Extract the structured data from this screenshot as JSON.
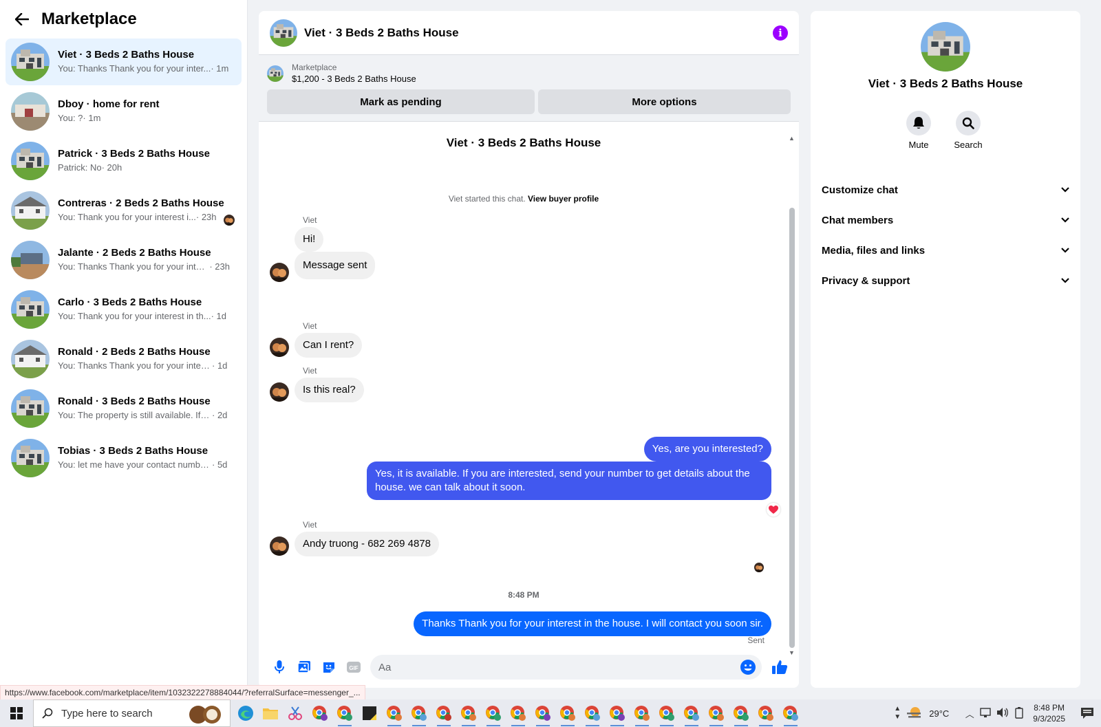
{
  "sidebar": {
    "title": "Marketplace",
    "conversations": [
      {
        "name": "Viet · 3 Beds 2 Baths House",
        "preview": "You: Thanks Thank you for your inter...",
        "time": " · 1m"
      },
      {
        "name": "Dboy · home for rent",
        "preview": "You: ?",
        "time": " · 1m"
      },
      {
        "name": "Patrick · 3 Beds 2 Baths House",
        "preview": "Patrick: No",
        "time": " · 20h"
      },
      {
        "name": "Contreras · 2 Beds 2 Baths House",
        "preview": "You: Thank you for your interest i...",
        "time": " · 23h"
      },
      {
        "name": "Jalante · 2 Beds 2 Baths House",
        "preview": "You: Thanks Thank you for your inter...",
        "time": " · 23h"
      },
      {
        "name": "Carlo · 3 Beds 2 Baths House",
        "preview": "You: Thank you for your interest in th...",
        "time": " · 1d"
      },
      {
        "name": "Ronald · 2 Beds 2 Baths House",
        "preview": "You: Thanks Thank you for your intere...",
        "time": " · 1d"
      },
      {
        "name": "Ronald · 3 Beds 2 Baths House",
        "preview": "You: The property is still available. If y...",
        "time": " · 2d"
      },
      {
        "name": "Tobias · 3 Beds 2 Baths House",
        "preview": "You: let me have your contact number...",
        "time": " · 5d"
      }
    ]
  },
  "chat": {
    "title": "Viet · 3 Beds 2 Baths House",
    "marketplace_label": "Marketplace",
    "item": "$1,200 - 3 Beds 2 Baths House",
    "mark_pending": "Mark as pending",
    "more_options": "More options",
    "thread_title": "Viet · 3 Beds 2 Baths House",
    "started_text": "Viet started this chat.",
    "view_profile": "View buyer profile",
    "sender_name": "Viet",
    "messages": {
      "m1": "Hi!",
      "m2": "Message sent",
      "m3": "Can I rent?",
      "m4": "Is this real?",
      "m5": "Yes, are you interested?",
      "m6": "Yes, it is available. If you are interested, send your number to get details about the house. we can talk about it soon.",
      "m7": "Andy truong  - 682 269 4878",
      "m8": "Thanks Thank you for your interest in the house. I will contact you soon sir."
    },
    "time_separator": "8:48 PM",
    "sent_label": "Sent",
    "composer_placeholder": "Aa"
  },
  "details": {
    "name": "Viet · 3 Beds 2 Baths House",
    "mute": "Mute",
    "search": "Search",
    "sections": [
      "Customize chat",
      "Chat members",
      "Media, files and links",
      "Privacy & support"
    ]
  },
  "status_url": "https://www.facebook.com/marketplace/item/1032322278884044/?referralSurface=messenger_...",
  "taskbar": {
    "search_placeholder": "Type here to search",
    "temperature": "29°C",
    "time": "8:48 PM",
    "date": "9/3/2025"
  },
  "colors": {
    "accent_purple": "#9b00ff",
    "outgoing_bubble": "#4158ef",
    "outgoing_bubble_latest": "#0866ff",
    "active_row": "#e7f3ff"
  }
}
